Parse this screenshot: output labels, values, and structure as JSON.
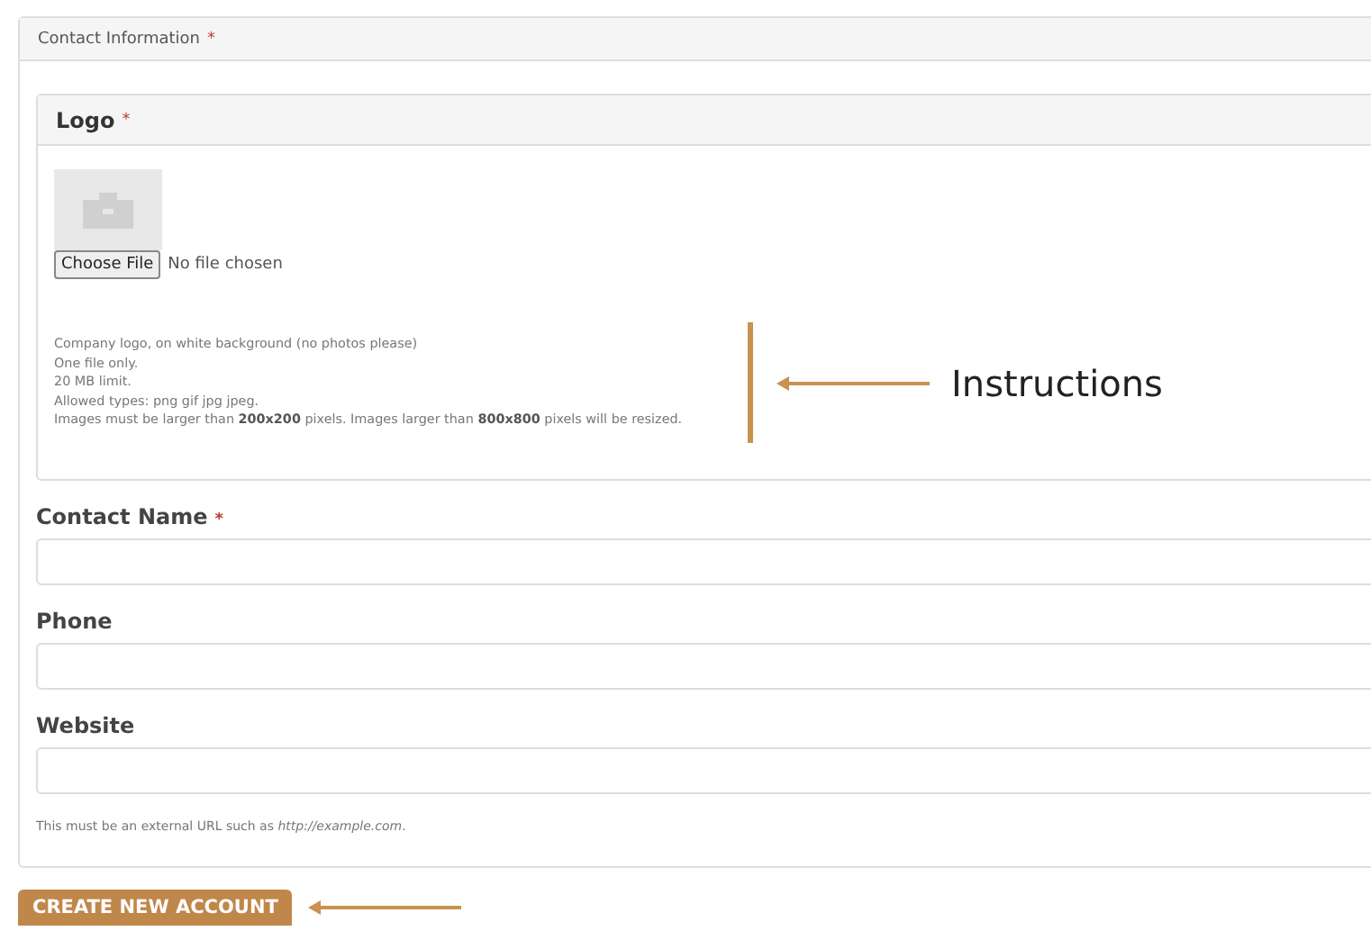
{
  "section": {
    "title": "Contact Information",
    "required_mark": "*"
  },
  "logo": {
    "title": "Logo",
    "required_mark": "*",
    "kind": "picture",
    "upload": {
      "button": "Choose File",
      "status": "No file chosen"
    },
    "instructions": [
      "Company logo, on white background (no photos please)",
      "One file only.",
      "20 MB limit.",
      "Allowed types: png gif jpg jpeg.",
      "Images must be larger than **200x200** pixels. Images larger than **800x800** pixels will be resized."
    ],
    "annotation": "Instructions"
  },
  "fields": [
    {
      "label": "Contact Name",
      "required_mark": "*"
    },
    {
      "label": "Phone"
    },
    {
      "label": "Website"
    }
  ],
  "website_hint": "This must be an external URL such as *http://example.com*.",
  "submit": "CREATE NEW ACCOUNT"
}
